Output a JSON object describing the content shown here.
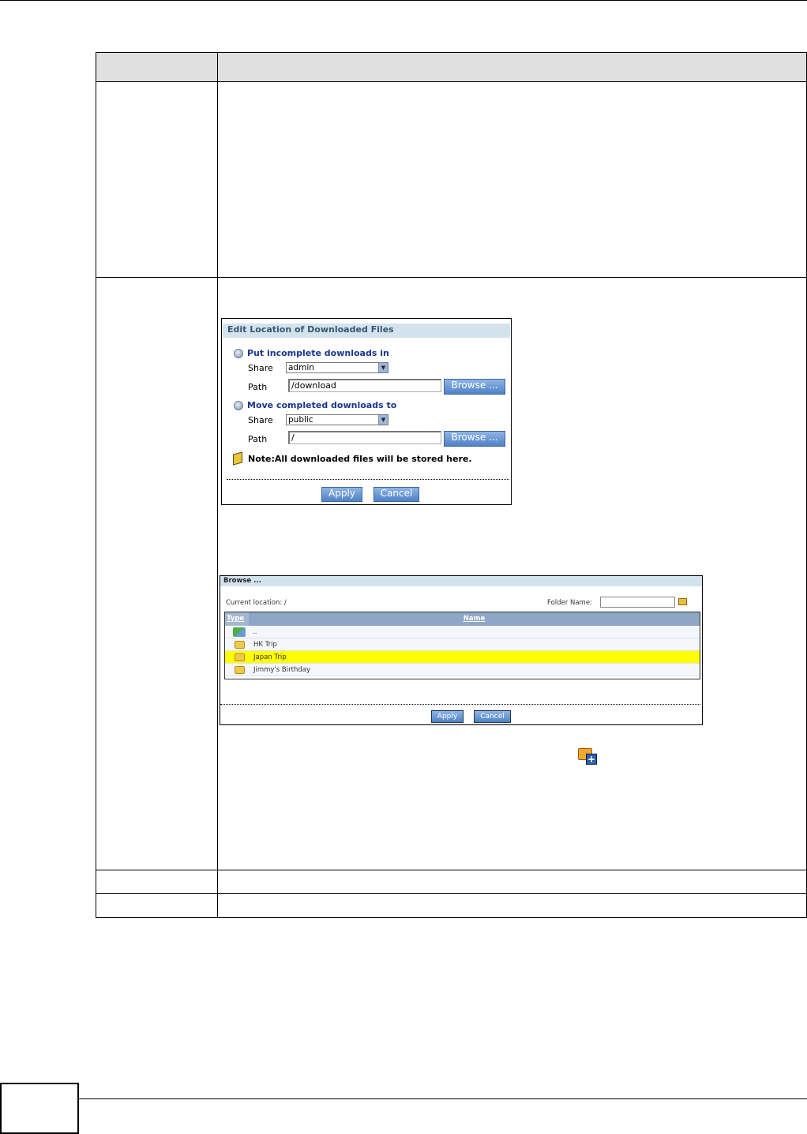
{
  "edit_location_dialog": {
    "title": "Edit Location of Downloaded Files",
    "incomplete_section": "Put incomplete downloads in",
    "completed_section": "Move completed downloads to",
    "share_label": "Share",
    "path_label": "Path",
    "incomplete_share": "admin",
    "incomplete_path": "/download",
    "completed_share": "public",
    "completed_path": "/",
    "browse_label": "Browse ...",
    "note": "Note:All downloaded files will be stored here.",
    "apply_label": "Apply",
    "cancel_label": "Cancel"
  },
  "browse_dialog": {
    "title": "Browse ...",
    "current_location": "Current location: /",
    "folder_name_label": "Folder Name:",
    "folder_name_value": "",
    "col_type": "Type",
    "col_name": "Name",
    "rows": [
      {
        "name": "..",
        "icon": "up-folder-icon"
      },
      {
        "name": "HK Trip",
        "icon": "folder-icon"
      },
      {
        "name": "Japan Trip",
        "icon": "folder-icon",
        "selected": true
      },
      {
        "name": "Jimmy's Birthday",
        "icon": "folder-icon"
      }
    ],
    "apply_label": "Apply",
    "cancel_label": "Cancel"
  }
}
